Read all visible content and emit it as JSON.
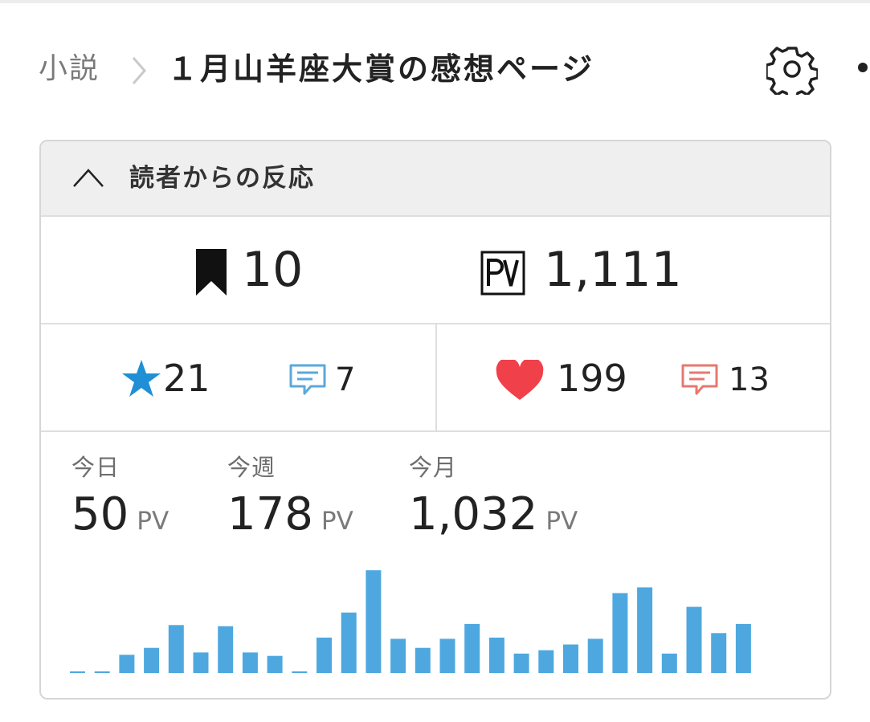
{
  "breadcrumb": {
    "parent": "小説",
    "title": "１月山羊座大賞の感想ページ"
  },
  "panel": {
    "title": "読者からの反応"
  },
  "counts": {
    "bookmarks": "10",
    "pv_total": "1,111",
    "stars": "21",
    "star_comments": "7",
    "hearts": "199",
    "heart_comments": "13"
  },
  "pv_stats": {
    "today": {
      "label": "今日",
      "value": "50",
      "unit": "PV"
    },
    "week": {
      "label": "今週",
      "value": "178",
      "unit": "PV"
    },
    "month": {
      "label": "今月",
      "value": "1,032",
      "unit": "PV"
    }
  },
  "icons": {
    "breadcrumb_separator": "chevron-right-icon",
    "settings": "gear-icon",
    "more": "more-icon",
    "collapse": "chevron-up-icon",
    "bookmark": "bookmark-icon",
    "pv": "pv-icon",
    "star": "star-icon",
    "star_comment": "comment-icon",
    "heart": "heart-icon",
    "heart_comment": "comment-icon"
  },
  "colors": {
    "bar": "#4ea8df",
    "star": "#1f8fd6",
    "heart": "#f0404a",
    "comment_blue": "#5aa9dc",
    "comment_red": "#e6786f"
  },
  "chart_data": {
    "type": "bar",
    "x": [
      1,
      2,
      3,
      4,
      5,
      6,
      7,
      8,
      9,
      10,
      11,
      12,
      13,
      14,
      15,
      16,
      17,
      18,
      19,
      20,
      21,
      22,
      23,
      24,
      25,
      26,
      27,
      28,
      29,
      30
    ],
    "values": [
      1,
      1,
      16,
      22,
      42,
      18,
      41,
      18,
      15,
      1,
      31,
      53,
      90,
      30,
      22,
      30,
      43,
      31,
      17,
      20,
      25,
      30,
      70,
      75,
      17,
      58,
      35,
      43
    ],
    "ylim": [
      0,
      95
    ],
    "grid": false,
    "legend": "none"
  }
}
